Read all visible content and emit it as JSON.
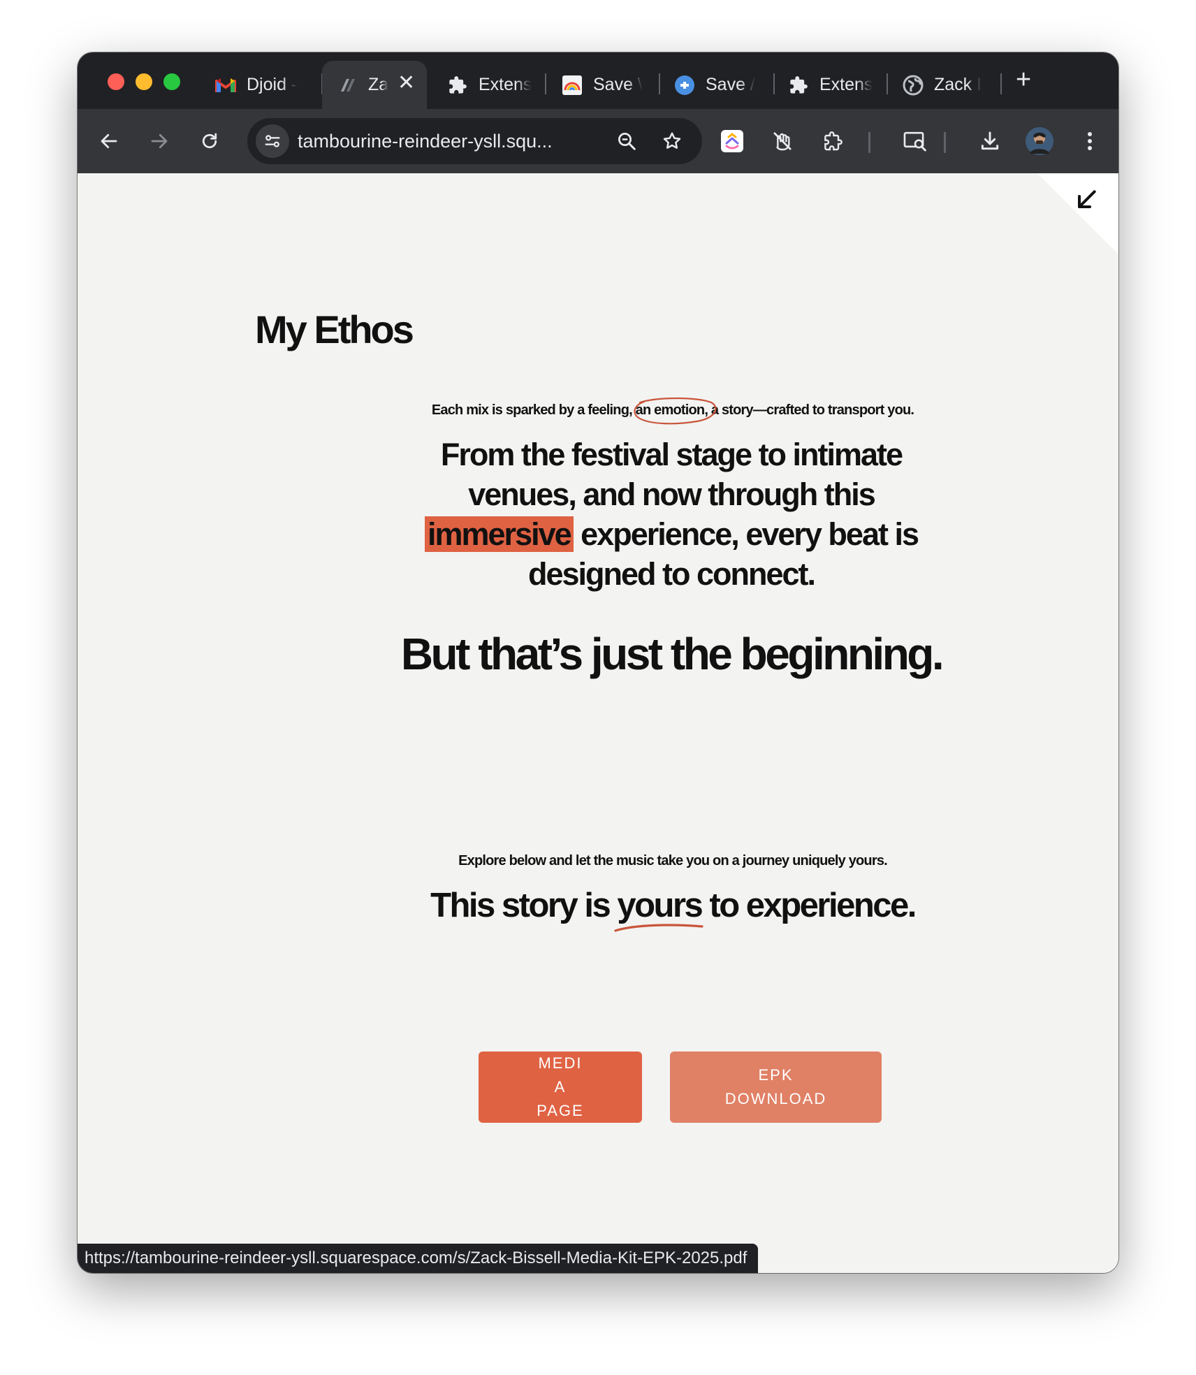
{
  "browser": {
    "tabs": [
      {
        "label": "Djoid -",
        "icon": "gmail-icon"
      },
      {
        "label": "Za",
        "icon": "squarespace-icon",
        "active": true
      },
      {
        "label": "Extens",
        "icon": "puzzle-icon"
      },
      {
        "label": "Save \\",
        "icon": "rainbow-icon"
      },
      {
        "label": "Save /",
        "icon": "extension-icon"
      },
      {
        "label": "Extens",
        "icon": "puzzle-icon"
      },
      {
        "label": "Zack I",
        "icon": "globe-icon"
      }
    ],
    "new_tab_label": "+",
    "close_label": "✕",
    "address": "tambourine-reindeer-ysll.squ...",
    "status_url": "https://tambourine-reindeer-ysll.squarespace.com/s/Zack-Bissell-Media-Kit-EPK-2025.pdf"
  },
  "page": {
    "heading": "My Ethos",
    "lead": {
      "before": "Each mix is sparked by a feeling, ",
      "circled": "an emotion, a",
      "after": " story—crafted to transport you."
    },
    "statement": {
      "line1": "From the festival stage to intimate venues, and now through this",
      "highlight": "immersive",
      "line2": " experience, every beat is designed to connect."
    },
    "tagline": "But that’s just the beginning.",
    "explore": "Explore below and let the music take you on a journey uniquely yours.",
    "story": {
      "before": "This story is ",
      "underlined": "yours",
      "after": " to experience."
    },
    "buttons": {
      "media": [
        "MEDI",
        "A",
        "PAGE"
      ],
      "epk": [
        "EPK",
        "DOWNLOAD"
      ]
    }
  },
  "colors": {
    "accent": "#df6243",
    "accent_light": "#e08065",
    "page_bg": "#f3f3f1",
    "chrome_dark": "#202124",
    "chrome_toolbar": "#35363a"
  }
}
